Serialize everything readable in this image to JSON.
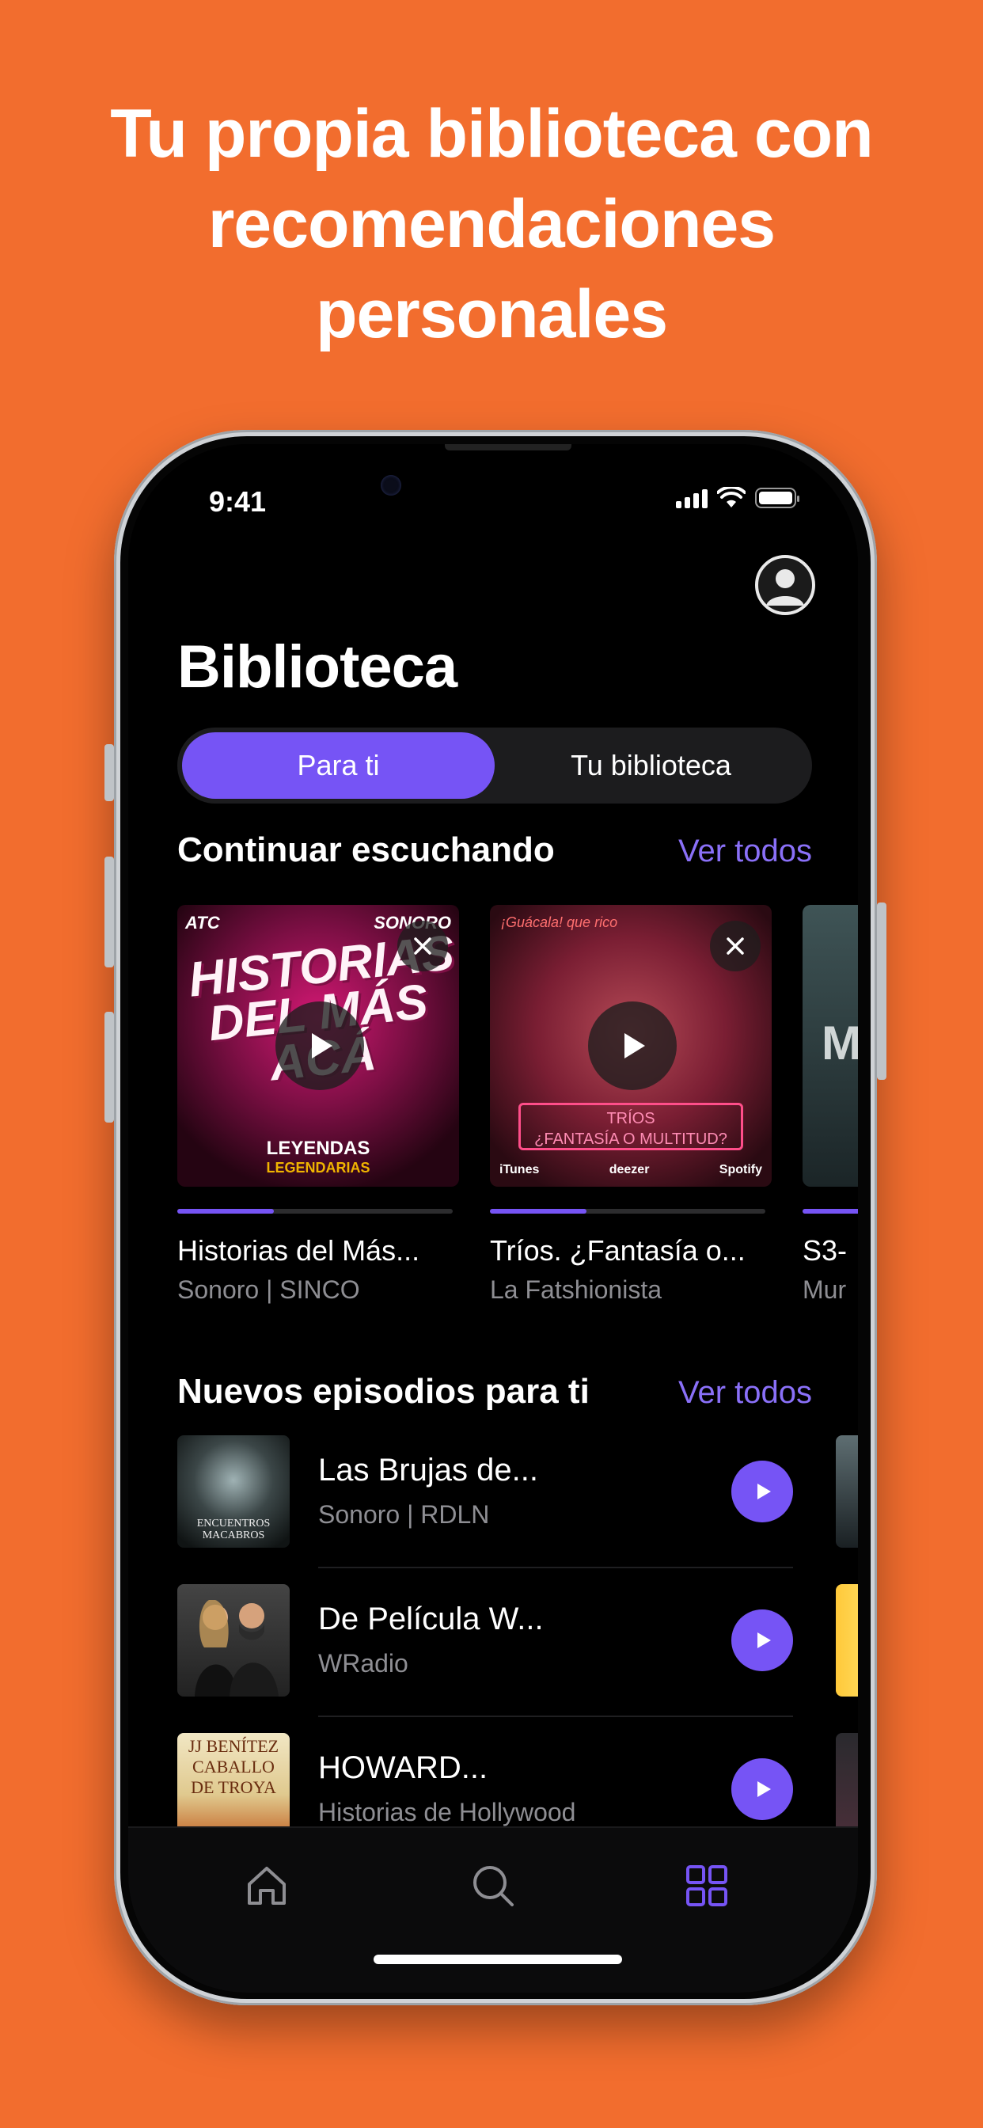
{
  "headline": [
    "Tu propia biblioteca con",
    "recomendaciones",
    "personales"
  ],
  "status": {
    "time": "9:41"
  },
  "page": {
    "title": "Biblioteca"
  },
  "tabs": [
    {
      "label": "Para ti",
      "selected": true
    },
    {
      "label": "Tu biblioteca",
      "selected": false
    }
  ],
  "continue_section": {
    "title": "Continuar escuchando",
    "see_all": "Ver todos",
    "cards": [
      {
        "title": "Historias del Más...",
        "subtitle": "Sonoro | SINCO",
        "progress": 0.35,
        "cover": {
          "logo_left": "ATC",
          "logo_right": "SONORO",
          "big_title": "HISTORIAS DEL MÁS ACÁ",
          "footer_main": "LEYENDAS",
          "footer_sub": "LEGENDARIAS"
        }
      },
      {
        "title": "Tríos. ¿Fantasía o...",
        "subtitle": "La Fatshionista",
        "progress": 0.35,
        "cover": {
          "tag": "¡Guácala! que rico",
          "box_line1": "TRÍOS",
          "box_line2": "¿FANTASÍA O MULTITUD?",
          "svc1": "iTunes",
          "svc2": "deezer",
          "svc3": "Spotify"
        }
      },
      {
        "title": "S3-",
        "subtitle": "Mur",
        "progress": 0.3,
        "cover": {
          "letter": "M"
        }
      }
    ]
  },
  "new_episodes_section": {
    "title": "Nuevos episodios para ti",
    "see_all": "Ver todos",
    "items": [
      {
        "title": "Las Brujas de...",
        "subtitle": "Sonoro | RDLN",
        "thumb_text": "ENCUENTROS MACABROS"
      },
      {
        "title": "De Película W...",
        "subtitle": "WRadio",
        "thumb_text": ""
      },
      {
        "title": "HOWARD...",
        "subtitle": "Historias de Hollywood",
        "thumb_text": "JJ BENÍTEZ CABALLO DE TROYA"
      }
    ]
  },
  "tabbar": [
    {
      "icon": "home-icon",
      "selected": false
    },
    {
      "icon": "search-icon",
      "selected": false
    },
    {
      "icon": "library-grid-icon",
      "selected": true
    }
  ],
  "colors": {
    "background": "#F26D2E",
    "accent": "#7654F5",
    "link": "#8A70F8"
  }
}
